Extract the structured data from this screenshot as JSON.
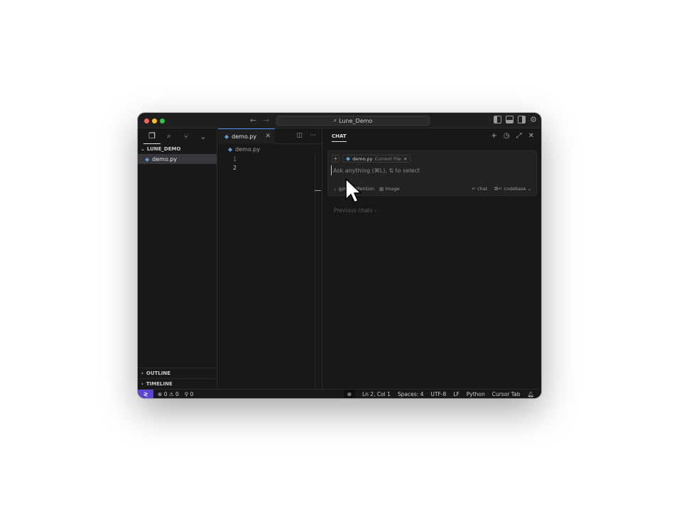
{
  "titlebar": {
    "search_text": "Lune_Demo",
    "back_icon": "arrow-left-icon",
    "forward_icon": "arrow-right-icon"
  },
  "sidebar": {
    "project_name": "LUNE_DEMO",
    "files": [
      {
        "name": "demo.py",
        "icon": "python-file-icon"
      }
    ],
    "sections": [
      "OUTLINE",
      "TIMELINE"
    ]
  },
  "editor": {
    "tab_label": "demo.py",
    "breadcrumb_file": "demo.py",
    "lines": [
      "1",
      "2"
    ]
  },
  "chat": {
    "title": "CHAT",
    "context_file": "demo.py",
    "context_label": "Current File",
    "input_placeholder": "Ask anything (⌘L), ⇅ to select",
    "options": {
      "model": "gpt",
      "mention": "Mention",
      "image": "Image",
      "send_chat": "↵ chat",
      "send_codebase": "⌘↵ codebase"
    },
    "previous_chats": "Previous chats"
  },
  "statusbar": {
    "errors": "0",
    "warnings": "0",
    "ports": "0",
    "position": "Ln 2, Col 1",
    "spaces": "Spaces: 4",
    "encoding": "UTF-8",
    "eol": "LF",
    "language": "Python",
    "cursor_tab": "Cursor Tab"
  },
  "colors": {
    "window_bg": "#181818",
    "accent_blue": "#3794ff",
    "remote_purple": "#5a47d6",
    "python_icon": "#5b9bd5"
  }
}
